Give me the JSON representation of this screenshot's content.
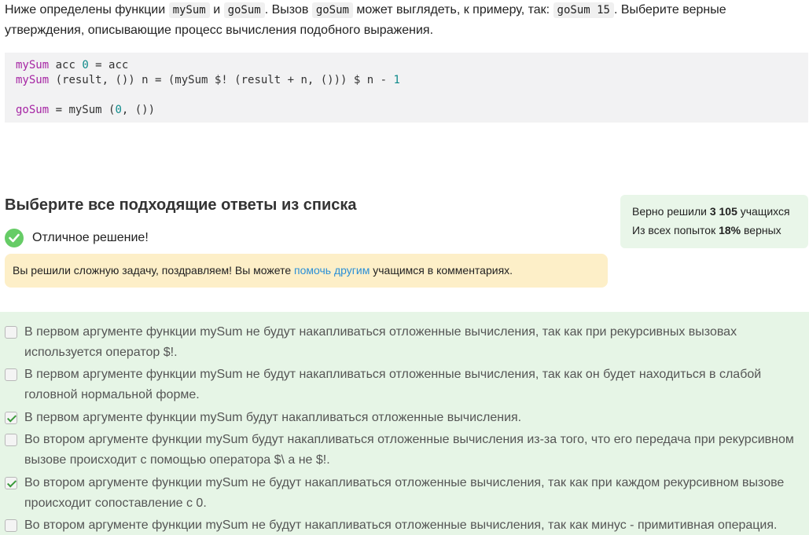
{
  "intro": {
    "t1": "Ниже определены функции",
    "c1": "mySum",
    "t2": "и",
    "c2": "goSum",
    "t3": ". Вызов",
    "c3": "goSum",
    "t4": "может выглядеть, к примеру, так:",
    "c4": "goSum 15",
    "t5": ". Выберите верные",
    "line2": "утверждения, описывающие процесс вычисления подобного выражения."
  },
  "code": {
    "l1_fn": "mySum",
    "l1_a": " acc ",
    "l1_num": "0",
    "l1_b": " = acc",
    "l2_fn": "mySum",
    "l2_a": " (result, ()) n = (mySum $! (result + n, ())) $ n - ",
    "l2_num": "1",
    "l4_fn": "goSum",
    "l4_a": " = mySum (",
    "l4_num": "0",
    "l4_b": ", ())"
  },
  "heading": "Выберите все подходящие ответы из списка",
  "result": {
    "label": "Отличное решение!"
  },
  "notice": {
    "before": "Вы решили сложную задачу, поздравляем! Вы можете ",
    "link": "помочь другим",
    "after": " учащимся в комментариях."
  },
  "stats": {
    "l1_a": "Верно решили ",
    "l1_b": "3 105",
    "l1_c": " учащихся",
    "l2_a": "Из всех попыток ",
    "l2_b": "18%",
    "l2_c": " верных"
  },
  "options": [
    {
      "text": "В первом аргументе функции mySum не будут накапливаться отложенные вычисления, так как при рекурсивных вызовах используется оператор $!.",
      "checked": false
    },
    {
      "text": "В первом аргументе функции mySum не будут накапливаться отложенные вычисления, так как он будет находиться в слабой головной нормальной форме.",
      "checked": false
    },
    {
      "text": "В первом аргументе функции mySum будут накапливаться отложенные вычисления.",
      "checked": true
    },
    {
      "text": "Во втором аргументе функции mySum будут накапливаться отложенные вычисления из-за того, что его передача при рекурсивном вызове происходит с помощью оператора $\\ а не $!.",
      "checked": false
    },
    {
      "text": "Во втором аргументе функции mySum не будут накапливаться отложенные вычисления, так как при каждом рекурсивном вызове происходит сопоставление с 0.",
      "checked": true
    },
    {
      "text": "Во втором аргументе функции mySum не будут накапливаться отложенные вычисления, так как минус - примитивная операция.",
      "checked": false
    }
  ]
}
